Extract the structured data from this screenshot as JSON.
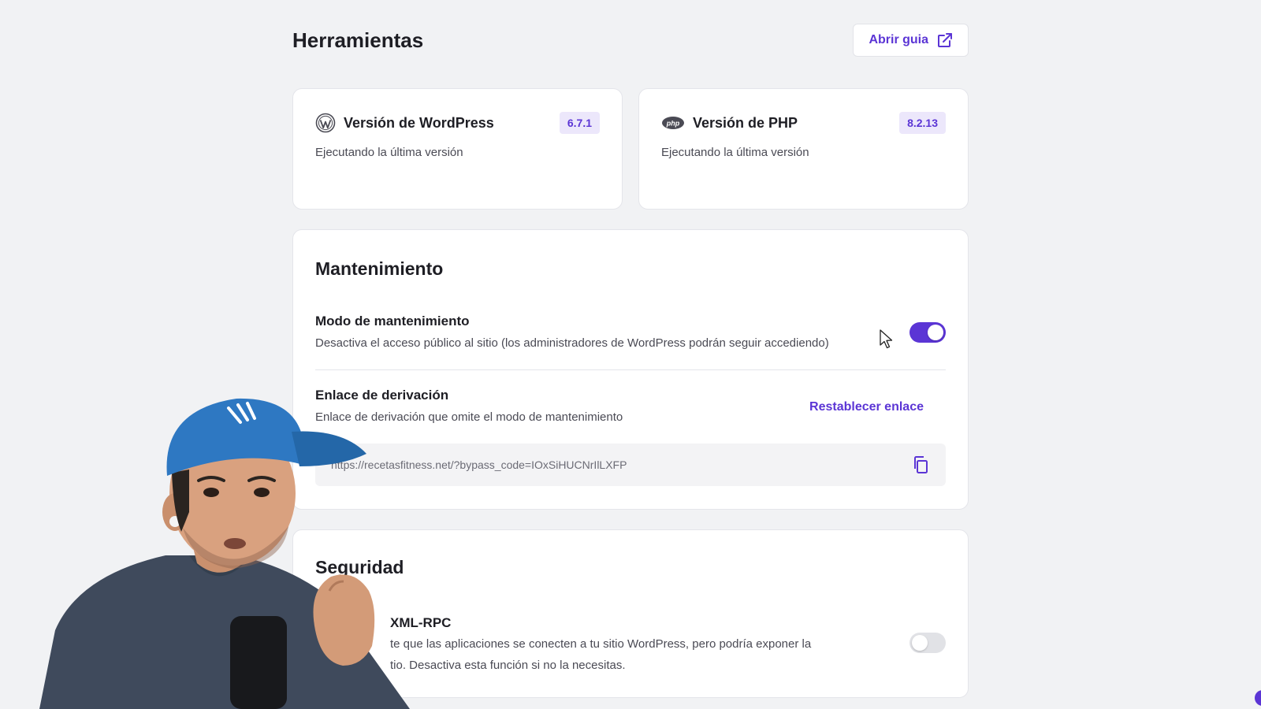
{
  "header": {
    "title": "Herramientas",
    "guide_label": "Abrir guia",
    "guide_icon": "external-link-icon"
  },
  "versions": {
    "wordpress": {
      "title": "Versión de WordPress",
      "badge": "6.7.1",
      "status": "Ejecutando la última versión",
      "icon": "wordpress-logo-icon"
    },
    "php": {
      "title": "Versión de PHP",
      "badge": "8.2.13",
      "status": "Ejecutando la última versión",
      "icon": "php-logo-icon"
    }
  },
  "maintenance": {
    "title": "Mantenimiento",
    "mode": {
      "title": "Modo de mantenimiento",
      "description": "Desactiva el acceso público al sitio (los administradores de WordPress podrán seguir accediendo)",
      "enabled": true
    },
    "bypass": {
      "title": "Enlace de derivación",
      "description": "Enlace de derivación que omite el modo de mantenimiento",
      "reset_label": "Restablecer enlace",
      "url": "https://recetasfitness.net/?bypass_code=IOxSiHUCNrIlLXFP",
      "copy_icon": "copy-icon"
    }
  },
  "security": {
    "title": "Seguridad",
    "xmlrpc": {
      "title": "XML-RPC",
      "description_line1": "te que las aplicaciones se conecten a tu sitio WordPress, pero podría exponer la",
      "description_line2": "tio. Desactiva esta función si no la necesitas.",
      "enabled": false
    }
  },
  "colors": {
    "accent": "#5b35d5",
    "background": "#f1f2f4",
    "card": "#ffffff"
  }
}
